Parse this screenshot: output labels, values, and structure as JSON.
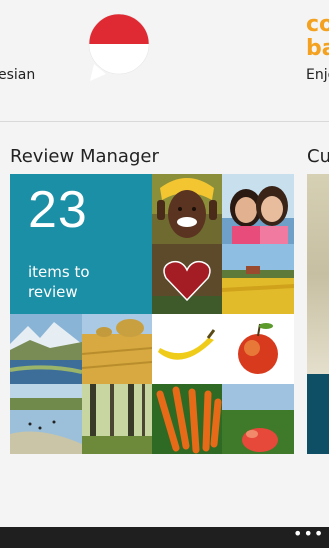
{
  "languages": {
    "left_label": "esian",
    "right_brand_line1": "co",
    "right_brand_line2": "ba",
    "right_label": "Enjo"
  },
  "review_manager": {
    "title": "Review Manager",
    "count": "23",
    "label": "items to review",
    "photo_tiles": [
      "smiling-person",
      "two-children",
      "heart-sign",
      "farm-field",
      "mountain-lake",
      "hay-bales",
      "banana",
      "apple",
      "lake-with-birds",
      "forest",
      "carrots",
      "strawberry"
    ]
  },
  "next_section": {
    "title": "Cu"
  },
  "colors": {
    "accent": "#1b8fa6",
    "appbar": "#1f1f1f",
    "flag_red": "#e02a33"
  },
  "app_bar": {
    "more_label": "•••"
  }
}
